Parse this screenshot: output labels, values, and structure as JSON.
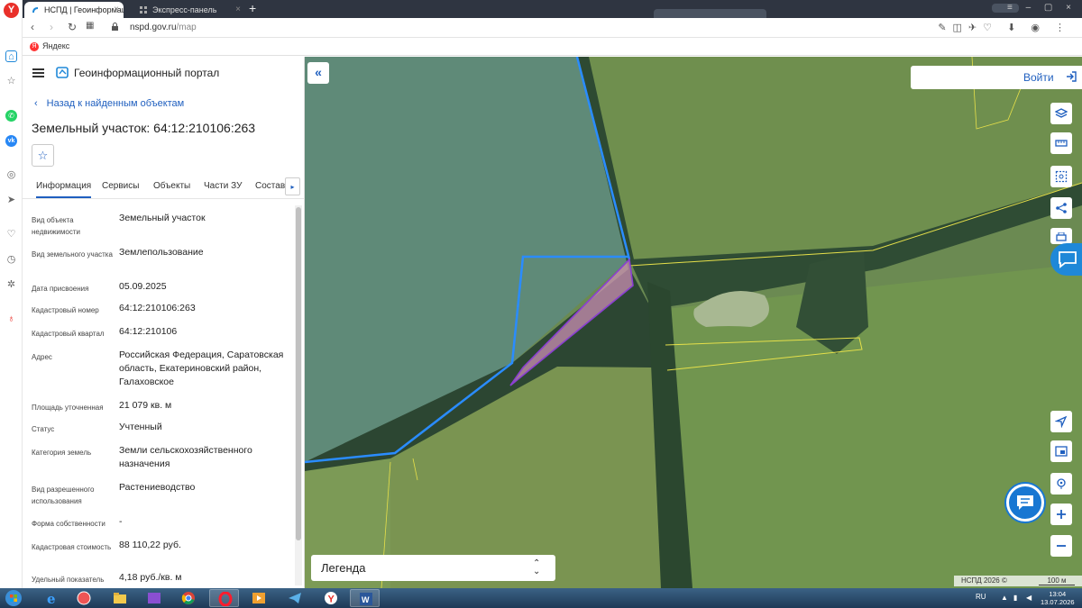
{
  "browser": {
    "tabs": [
      {
        "label": "НСПД | Геоинформационн",
        "active": true
      },
      {
        "label": "Экспресс-панель",
        "active": false
      }
    ],
    "url_host": "nspd.gov.ru",
    "url_path": "/map",
    "bookmark": "Яндекс",
    "yandex_logo": "Y"
  },
  "panel": {
    "portal_title": "Геоинформационный портал",
    "back_label": "Назад к найденным объектам",
    "object_title": "Земельный участок: 64:12:210106:263",
    "tabs": [
      "Информация",
      "Сервисы",
      "Объекты",
      "Части ЗУ",
      "Состав"
    ],
    "attributes": [
      {
        "label": "Вид объекта недвижимости",
        "value": "Земельный участок"
      },
      {
        "label": "Вид земельного участка",
        "value": "Землепользование"
      },
      {
        "label": "Дата присвоения",
        "value": "05.09.2025"
      },
      {
        "label": "Кадастровый номер",
        "value": "64:12:210106:263"
      },
      {
        "label": "Кадастровый квартал",
        "value": "64:12:210106"
      },
      {
        "label": "Адрес",
        "value": "Российская Федерация, Саратовская область, Екатериновский район, Галаховское"
      },
      {
        "label": "Площадь уточненная",
        "value": "21 079 кв. м"
      },
      {
        "label": "Статус",
        "value": "Учтенный"
      },
      {
        "label": "Категория земель",
        "value": "Земли сельскохозяйственного назначения"
      },
      {
        "label": "Вид разрешенного использования",
        "value": "Растениеводство"
      },
      {
        "label": "Форма собственности",
        "value": "-"
      },
      {
        "label": "Кадастровая стоимость",
        "value": "88 110,22 руб."
      },
      {
        "label": "Удельный показатель",
        "value": "4,18 руб./кв. м"
      }
    ]
  },
  "map": {
    "login_label": "Войти",
    "legend_label": "Легенда",
    "copyright": "НСПД 2026 ©",
    "scale": "100 м",
    "tools": [
      "layers-icon",
      "ruler-icon",
      "select-area-icon",
      "share-icon",
      "print-icon"
    ],
    "zoom": [
      "locate-icon",
      "minimap-icon",
      "geolocation-icon",
      "zoom-in-icon",
      "zoom-out-icon"
    ],
    "colors": {
      "parcel_outline": "#2a8cff",
      "selected_fill": "#c98fb3",
      "selected_outline": "#8a3fd1",
      "field_boundary": "#e6e04a"
    }
  },
  "taskbar": {
    "lang": "RU",
    "time": "13:04",
    "date": "13.07.2026"
  }
}
